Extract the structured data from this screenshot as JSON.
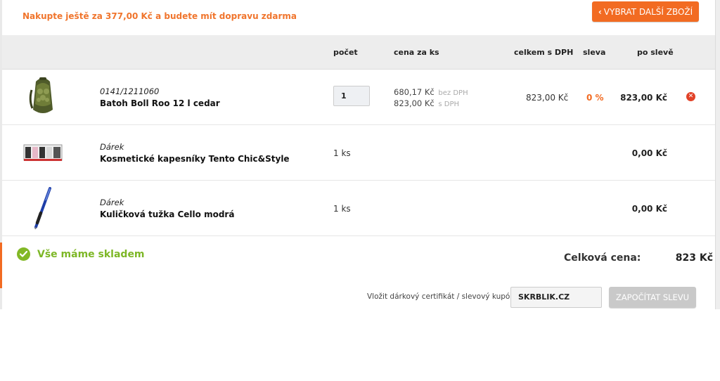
{
  "free_shipping_notice": "Nakupte ještě za 377,00 Kč a budete mít dopravu zdarma",
  "continue_button": "VYBRAT DALŠÍ ZBOŽÍ",
  "columns": {
    "qty": "počet",
    "unit_price": "cena za ks",
    "total_vat": "celkem s DPH",
    "discount": "sleva",
    "after_discount": "po slevě"
  },
  "items": [
    {
      "code": "0141/1211060",
      "name": "Batoh Boll Roo 12 l cedar",
      "qty": "1",
      "price_ex_vat": "680,17 Kč",
      "price_ex_vat_tag": "bez DPH",
      "price_inc_vat": "823,00 Kč",
      "price_inc_vat_tag": "s DPH",
      "total": "823,00 Kč",
      "discount": "0 %",
      "after_discount": "823,00 Kč",
      "image_icon": "backpack-image"
    },
    {
      "code": "Dárek",
      "name": "Kosmetické kapesníky Tento Chic&Style",
      "qty_text": "1 ks",
      "after_discount": "0,00 Kč",
      "image_icon": "tissues-image"
    },
    {
      "code": "Dárek",
      "name": "Kuličková tužka Cello modrá",
      "qty_text": "1 ks",
      "after_discount": "0,00 Kč",
      "image_icon": "pen-image"
    }
  ],
  "stock_status": "Vše máme skladem",
  "total_label": "Celková cena:",
  "total_value": "823 Kč",
  "coupon": {
    "label": "Vložit dárkový certifikát / slevový kupón:",
    "value": "SKRBLIK.CZ",
    "apply_button": "ZAPOČÍTAT SLEVU"
  },
  "colors": {
    "accent": "#f26b22",
    "success": "#7db726",
    "remove": "#e24228",
    "header_bg": "#ededed"
  }
}
